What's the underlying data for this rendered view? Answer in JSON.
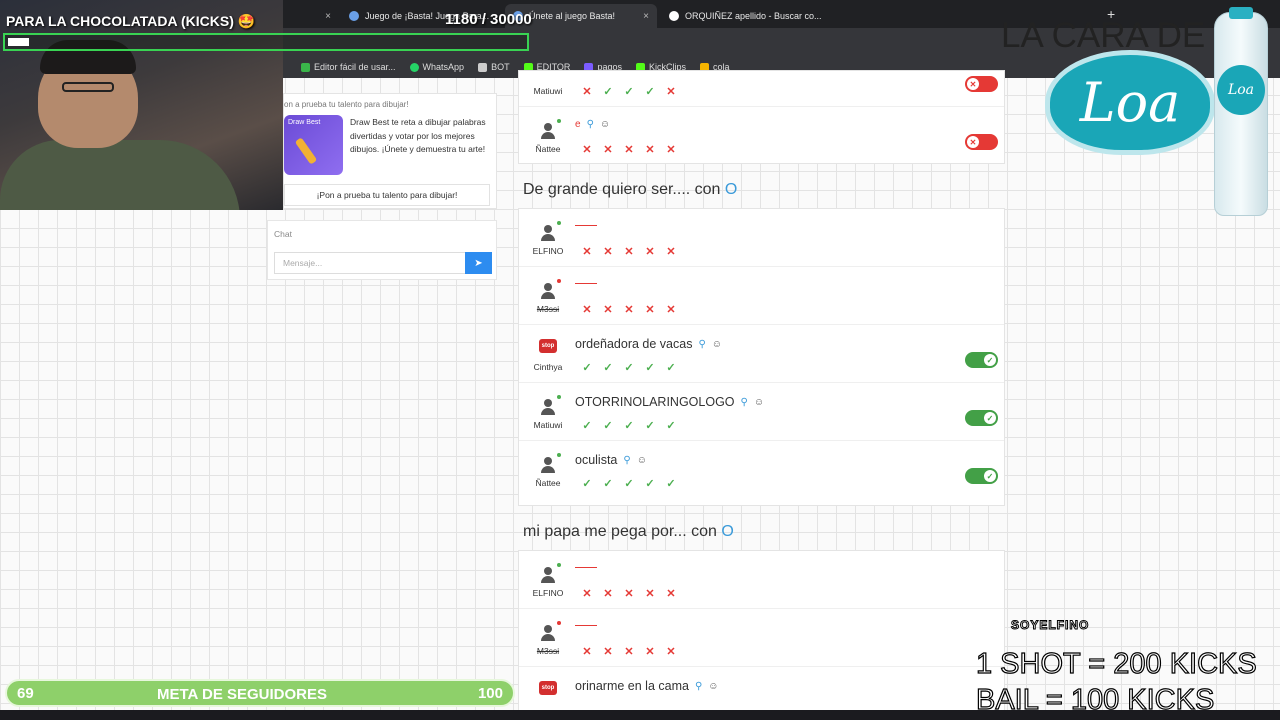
{
  "overlay": {
    "stream_title": "PARA LA CHOCOLATADA (KICKS) 🤩",
    "kicks_counter": "1180  / 30000",
    "kicks_progress": 0.04,
    "brand_title": "LA CARA DE",
    "brand_logo": "Loa",
    "streamer_tag": "SOYELFINO",
    "promo_line_1": "1 SHOT = 200 KICKS",
    "promo_line_2": "BAIL = 100 KICKS"
  },
  "browser": {
    "tabs": [
      {
        "label": "",
        "close": "×"
      },
      {
        "label": "Juego de ¡Basta! Juega Para...",
        "close": "×"
      },
      {
        "label": "Únete al juego Basta!",
        "close": "×"
      },
      {
        "label": "ORQUIÑEZ apellido - Buscar co...",
        "close": "×"
      }
    ],
    "new_tab": "+",
    "bookmarks": [
      {
        "label": "Editor fácil de usar...",
        "color": "#3ab54a"
      },
      {
        "label": "WhatsApp",
        "color": "#25d366"
      },
      {
        "label": "BOT",
        "color": "#cccccc"
      },
      {
        "label": "EDITOR",
        "color": "#53fc18"
      },
      {
        "label": "pagos",
        "color": "#7b5cff"
      },
      {
        "label": "KickClips",
        "color": "#53fc18"
      },
      {
        "label": "cola",
        "color": "#f5b400"
      }
    ]
  },
  "ad": {
    "heading": "on a prueba tu talento para dibujar!",
    "image_caption": "Draw Best",
    "text": "Draw Best te reta a dibujar palabras divertidas y votar por los mejores dibujos. ¡Únete y demuestra tu arte!",
    "button": "¡Pon a prueba tu talento para dibujar!"
  },
  "chat": {
    "label": "Chat",
    "placeholder": "Mensaje..."
  },
  "top_partial": {
    "rows": [
      {
        "name": "Matiuwi",
        "votes": [
          "x",
          "check",
          "check",
          "check",
          "x"
        ],
        "toggle": "off"
      },
      {
        "name": "Ñattee",
        "answer_mark": "e",
        "votes": [
          "x",
          "x",
          "x",
          "x",
          "x"
        ],
        "toggle": "off"
      }
    ]
  },
  "sections": [
    {
      "title": "De grande quiero ser.... con",
      "letter": "O",
      "rows": [
        {
          "name": "ELFINO",
          "answer": "",
          "votes": [
            "x",
            "x",
            "x",
            "x",
            "x"
          ],
          "toggle": null,
          "status": "online"
        },
        {
          "name": "M3ssi",
          "answer": "",
          "votes": [
            "x",
            "x",
            "x",
            "x",
            "x"
          ],
          "toggle": null,
          "status": "away",
          "strike": true
        },
        {
          "name": "Cinthya",
          "answer": "ordeñadora de vacas",
          "votes": [
            "check",
            "check",
            "check",
            "check",
            "check"
          ],
          "toggle": "on",
          "badge": "stop"
        },
        {
          "name": "Matiuwi",
          "answer": "OTORRINOLARINGOLOGO",
          "votes": [
            "check",
            "check",
            "check",
            "check",
            "check"
          ],
          "toggle": "on"
        },
        {
          "name": "Ñattee",
          "answer": "oculista",
          "votes": [
            "check",
            "check",
            "check",
            "check",
            "check"
          ],
          "toggle": "on"
        }
      ]
    },
    {
      "title": "mi papa me pega por... con",
      "letter": "O",
      "rows": [
        {
          "name": "ELFINO",
          "answer": "",
          "votes": [
            "x",
            "x",
            "x",
            "x",
            "x"
          ],
          "toggle": null,
          "status": "online"
        },
        {
          "name": "M3ssi",
          "answer": "",
          "votes": [
            "x",
            "x",
            "x",
            "x",
            "x"
          ],
          "toggle": null,
          "status": "away",
          "strike": true
        },
        {
          "name": "Cinthya",
          "answer": "orinarme en la cama",
          "votes": [],
          "toggle": null,
          "badge": "stop"
        }
      ]
    }
  ],
  "goal": {
    "current": "69",
    "label": "META DE SEGUIDORES",
    "target": "100",
    "progress": 0.69
  },
  "icons": {
    "search": "search-icon",
    "emoji": "emoji-icon",
    "check": "✓",
    "cross": "✕",
    "send": "➤"
  }
}
